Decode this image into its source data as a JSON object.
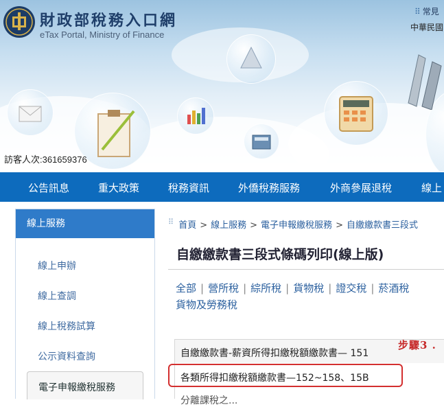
{
  "header": {
    "title": "財政部稅務入口網",
    "subtitle": "eTax Portal, Ministry of Finance",
    "top_link": "常見",
    "date_text": "中華民國",
    "visitor": "訪客人次:361659376"
  },
  "nav": {
    "items": [
      "公告訊息",
      "重大政策",
      "稅務資訊",
      "外僑稅務服務",
      "外商參展退稅",
      "線上"
    ]
  },
  "sidebar": {
    "title": "線上服務",
    "items": [
      "線上申辦",
      "線上查調",
      "線上稅務試算",
      "公示資料查詢"
    ],
    "active_item": "電子申報繳稅服務"
  },
  "breadcrumb": [
    "首頁",
    "線上服務",
    "電子申報繳稅服務",
    "自繳繳款書三段式"
  ],
  "page_title": "自繳繳款書三段式條碼列印(線上版)",
  "tax_filter": [
    "全部",
    "營所稅",
    "綜所稅",
    "貨物稅",
    "證交稅",
    "菸酒稅"
  ],
  "tax_filter_last": "貨物及勞務稅",
  "list": {
    "rows": [
      "自繳繳款書-薪資所得扣繳稅額繳款書— 151",
      "各類所得扣繳稅額繳款書—152~158、15B",
      "分離課稅之..."
    ]
  },
  "annotation": {
    "step_label": "步驟3 .",
    "color": "#d32f2f"
  },
  "colors": {
    "nav_bg": "#0d6bbd",
    "sidebar_title_bg": "#2f7bc9",
    "link": "#2a5f9e"
  }
}
